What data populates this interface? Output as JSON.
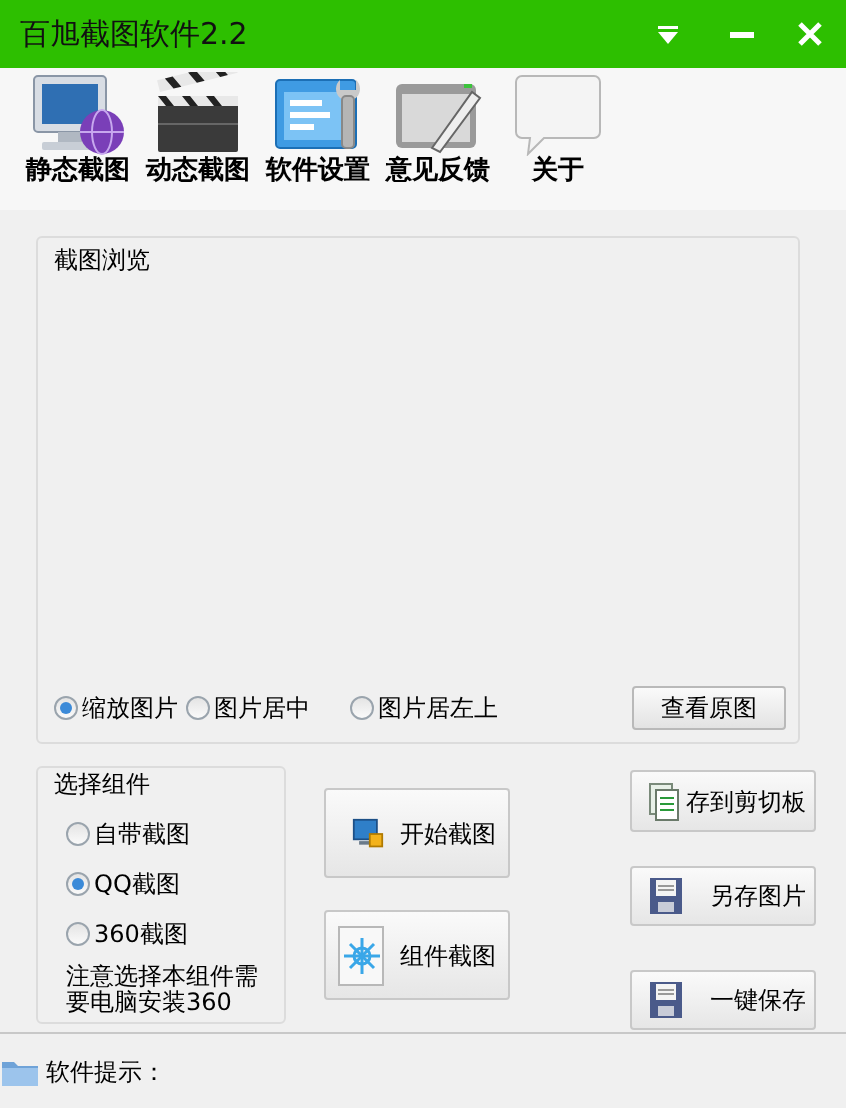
{
  "window": {
    "title": "百旭截图软件2.2"
  },
  "toolbar": [
    {
      "label": "静态截图",
      "kind": "monitor"
    },
    {
      "label": "动态截图",
      "kind": "clapper"
    },
    {
      "label": "软件设置",
      "kind": "settings"
    },
    {
      "label": "意见反馈",
      "kind": "feedback"
    },
    {
      "label": "关于",
      "kind": "about"
    }
  ],
  "preview": {
    "title": "截图浏览",
    "modes": [
      {
        "label": "缩放图片",
        "selected": true
      },
      {
        "label": "图片居中",
        "selected": false
      },
      {
        "label": "图片居左上",
        "selected": false
      }
    ],
    "button": "查看原图"
  },
  "components": {
    "title": "选择组件",
    "options": [
      {
        "label": "自带截图",
        "selected": false
      },
      {
        "label": "QQ截图",
        "selected": true
      },
      {
        "label": "360截图",
        "selected": false
      }
    ],
    "note": "注意选择本组件需要电脑安装360"
  },
  "actions": [
    {
      "label": "开始截图",
      "kind": "capture"
    },
    {
      "label": "组件截图",
      "kind": "component"
    }
  ],
  "save_buttons": [
    {
      "label": "存到剪切板",
      "kind": "clipboard"
    },
    {
      "label": "另存图片",
      "kind": "floppy"
    },
    {
      "label": "一键保存",
      "kind": "floppy"
    }
  ],
  "status_bar": {
    "label": "软件提示："
  }
}
